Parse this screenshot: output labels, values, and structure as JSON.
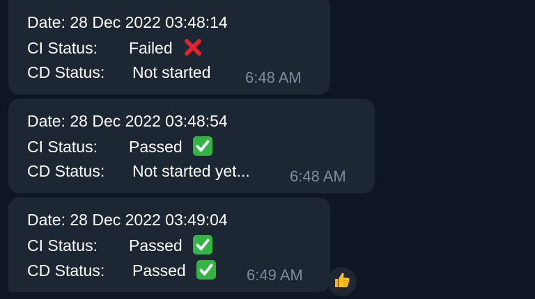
{
  "messages": [
    {
      "date": "Date: 28 Dec 2022 03:48:14",
      "ci_label": "CI Status:",
      "ci_value": "Failed",
      "ci_icon": "cross-mark-icon",
      "cd_label": "CD Status:",
      "cd_value": "Not started",
      "time": "6:48 AM"
    },
    {
      "date": "Date: 28 Dec 2022 03:48:54",
      "ci_label": "CI Status:",
      "ci_value": "Passed",
      "ci_icon": "check-mark-icon",
      "cd_label": "CD Status:",
      "cd_value": "Not started yet...",
      "time": "6:48 AM"
    },
    {
      "date": "Date: 28 Dec 2022 03:49:04",
      "ci_label": "CI Status:",
      "ci_value": "Passed",
      "ci_icon": "check-mark-icon",
      "cd_label": "CD Status:",
      "cd_value": "Passed",
      "cd_icon": "check-mark-icon",
      "time": "6:49 AM"
    }
  ],
  "reaction": {
    "icon": "thumbs-up-icon"
  },
  "colors": {
    "background": "#0e1621",
    "bubble": "#1d2733",
    "text": "#ffffff",
    "timestamp": "#7f8b98",
    "failed": "#e0242e",
    "passed": "#35b446"
  }
}
